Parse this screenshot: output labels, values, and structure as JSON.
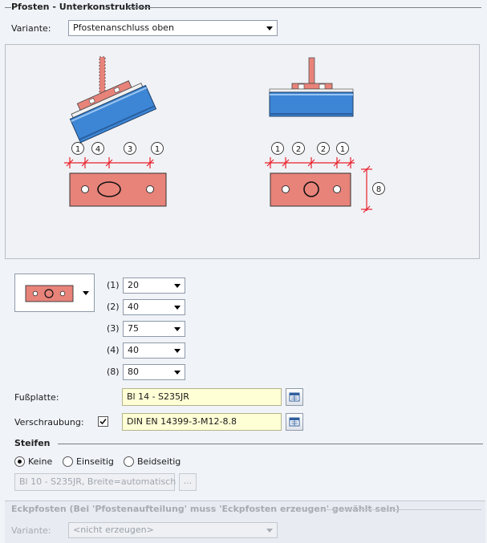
{
  "section_main": {
    "title": "Pfosten - Unterkonstruktion"
  },
  "variant": {
    "label": "Variante:",
    "value": "Pfostenanschluss oben"
  },
  "preview": {
    "left_dims": [
      "1",
      "4",
      "3",
      "1"
    ],
    "right_dims": [
      "1",
      "2",
      "2",
      "1"
    ],
    "right_height_dim": "8"
  },
  "dimensions": [
    {
      "label": "(1)",
      "value": "20"
    },
    {
      "label": "(2)",
      "value": "40"
    },
    {
      "label": "(3)",
      "value": "75"
    },
    {
      "label": "(4)",
      "value": "40"
    },
    {
      "label": "(8)",
      "value": "80"
    }
  ],
  "fussplatte": {
    "label": "Fußplatte:",
    "value": "Bl 14 - S235JR"
  },
  "verschraubung": {
    "label": "Verschraubung:",
    "checked": true,
    "value": "DIN EN 14399-3-M12-8.8"
  },
  "steifen": {
    "title": "Steifen",
    "options": [
      {
        "label": "Keine",
        "selected": true
      },
      {
        "label": "Einseitig",
        "selected": false
      },
      {
        "label": "Beidseitig",
        "selected": false
      }
    ],
    "field_value": "Bl 10 - S235JR, Breite=automatisch",
    "more_button": "..."
  },
  "eckpfosten": {
    "title": "Eckpfosten (Bei 'Pfostenaufteilung' muss 'Eckpfosten erzeugen' gewählt sein)",
    "variant_label": "Variante:",
    "variant_value": "<nicht erzeugen>"
  },
  "colors": {
    "plate": "#e8837a",
    "beam": "#3d86d6",
    "dim_line": "#e8202a",
    "field_yellow": "#ffffd6"
  }
}
